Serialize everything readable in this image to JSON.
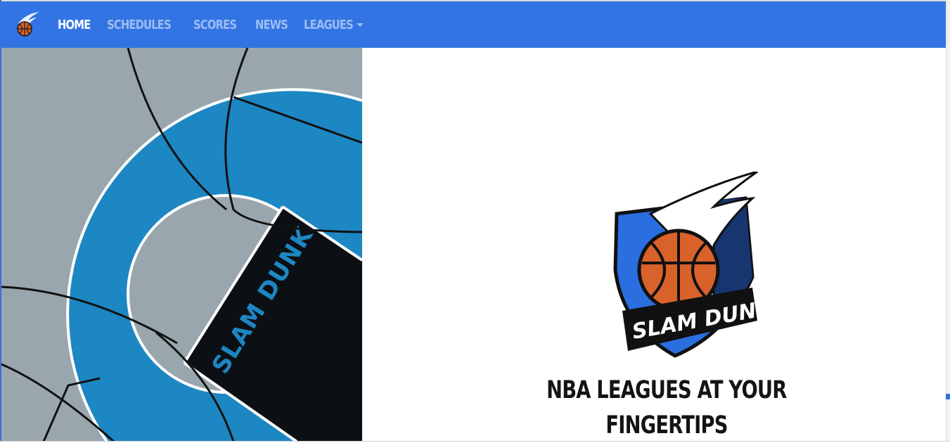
{
  "brand": {
    "icon": "basketball-comet-icon"
  },
  "nav": {
    "items": [
      {
        "label": "HOME",
        "active": true
      },
      {
        "label": "SCHEDULES",
        "active": false
      },
      {
        "label": "SCORES",
        "active": false
      },
      {
        "label": "NEWS",
        "active": false
      },
      {
        "label": "LEAGUES",
        "active": false,
        "dropdown": true
      }
    ]
  },
  "hero": {
    "court_text": "SLAM DUNK",
    "logo_text": "SLAM DUNK",
    "tagline_line1": "NBA LEAGUES AT YOUR",
    "tagline_line2": "FINGERTIPS"
  },
  "colors": {
    "navbar": "#3274e4",
    "nav_active": "#ffffff",
    "nav_inactive": "#9fbcf2",
    "court_gray": "#9aa6ae",
    "court_blue": "#1c87c2",
    "paint_black": "#0c1015",
    "ball_orange": "#d9622b"
  }
}
